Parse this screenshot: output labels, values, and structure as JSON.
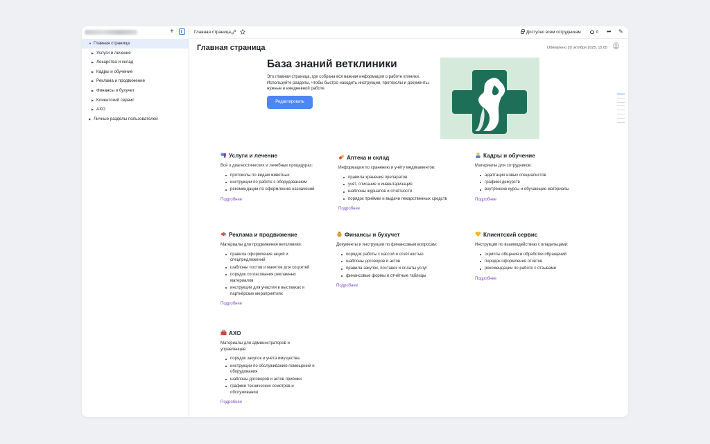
{
  "sidebar": {
    "items": [
      {
        "label": "Главная страница",
        "arrow": "▼",
        "active": true,
        "level": 0
      },
      {
        "label": "Услуги и лечение",
        "arrow": "▶",
        "active": false,
        "level": 1
      },
      {
        "label": "Лекарства и склад",
        "arrow": "▶",
        "active": false,
        "level": 1
      },
      {
        "label": "Кадры и обучение",
        "arrow": "▶",
        "active": false,
        "level": 1
      },
      {
        "label": "Реклама и продвижение",
        "arrow": "▶",
        "active": false,
        "level": 1
      },
      {
        "label": "Финансы и бухучет",
        "arrow": "▶",
        "active": false,
        "level": 1
      },
      {
        "label": "Клиентский сервис",
        "arrow": "▶",
        "active": false,
        "level": 1
      },
      {
        "label": "АХО",
        "arrow": "▶",
        "active": false,
        "level": 1
      },
      {
        "label": "Личные разделы пользователей",
        "arrow": "▶",
        "active": false,
        "level": 0
      }
    ],
    "plus": "+"
  },
  "topbar": {
    "breadcrumb": "Главная страница",
    "access": "Доступно всем сотрудникам",
    "comments_count": "0",
    "more": "•••",
    "edit_icon": "✎"
  },
  "page": {
    "title": "Главная страница",
    "updated": "Обновлено 20 октября 2025, 15:05"
  },
  "hero": {
    "title": "База знаний ветклиники",
    "description": "Это главная страница, где собрана вся важная информация о работе клиники. Используйте разделы, чтобы быстро находить инструкции, протоколы и документы, нужные в ежедневной работе.",
    "button": "Редактировать"
  },
  "colors": {
    "accent": "#4c86f5",
    "link": "#7b4fc9",
    "logo_green": "#1e6f58",
    "logo_bg": "#d6eadc"
  },
  "cards": [
    {
      "title": "Услуги и лечение",
      "icon": "stethoscope-icon",
      "desc": "Всё о диагностических и лечебных процедурах:",
      "items": [
        "протоколы по видам животных",
        "инструкции по работе с оборудованием",
        "рекомендации по оформлению назначений"
      ],
      "link": "Подробнее"
    },
    {
      "title": "Аптека и склад",
      "icon": "pill-icon",
      "desc": "Информация по хранению и учёту медикаментов:",
      "items": [
        "правила хранения препаратов",
        "учёт, списание и инвентаризация",
        "шаблоны журналов и отчётности",
        "порядок приёмки и выдачи лекарственных средств"
      ],
      "link": "Подробнее"
    },
    {
      "title": "Кадры и обучение",
      "icon": "person-icon",
      "desc": "Материалы для сотрудников:",
      "items": [
        "адаптация новых специалистов",
        "графики дежурств",
        "внутренние курсы и обучающие материалы"
      ],
      "link": "Подробнее"
    },
    {
      "title": "Реклама и продвижение",
      "icon": "megaphone-icon",
      "desc": "Материалы для продвижения ветклиники:",
      "items": [
        "правила оформления акций и спецпредложений",
        "шаблоны постов и макетов для соцсетей",
        "порядок согласования рекламных материалов",
        "инструкции для участия в выставках и партнёрских мероприятиях"
      ],
      "link": "Подробнее"
    },
    {
      "title": "Финансы и бухучет",
      "icon": "money-bag-icon",
      "desc": "Документы и инструкции по финансовым вопросам:",
      "items": [
        "порядок работы с кассой и отчётностью",
        "шаблоны договоров и актов",
        "правила закупок, поставок и оплаты услуг",
        "финансовые формы и отчётные таблицы"
      ],
      "link": "Подробнее"
    },
    {
      "title": "Клиентский сервис",
      "icon": "heart-icon",
      "desc": "Инструкции по взаимодействию с владельцами:",
      "items": [
        "скрипты общения и обработки обращений",
        "порядок оформления отчетов",
        "рекомендации по работе с отзывами"
      ],
      "link": "Подробнее"
    },
    {
      "title": "АХО",
      "icon": "toolbox-icon",
      "desc": "Материалы для администраторов и управленцев:",
      "items": [
        "порядок закупок и учёта имущества",
        "инструкции по обслуживанию помещений и оборудования",
        "шаблоны договоров и актов приёмки",
        "графики технических осмотров и обслуживания"
      ],
      "link": "Подробнее"
    }
  ]
}
